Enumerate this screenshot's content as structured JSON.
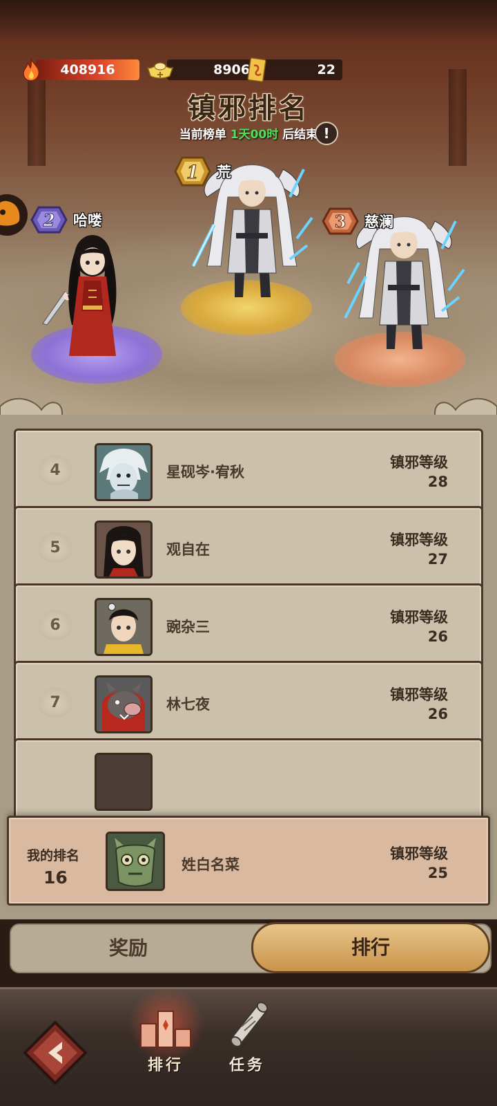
{
  "currency": {
    "flame": "408916",
    "gold": "8906",
    "ticket": "22"
  },
  "header": {
    "title": "镇邪排名",
    "timer_prefix": "当前榜单",
    "timer_value": "1天00时",
    "timer_suffix": "后结束",
    "info_symbol": "!"
  },
  "podium": [
    {
      "rank": "1",
      "name": "荒"
    },
    {
      "rank": "2",
      "name": "哈喽"
    },
    {
      "rank": "3",
      "name": "慈澜"
    }
  ],
  "ranking": {
    "level_label": "镇邪等级",
    "rows": [
      {
        "rank": "4",
        "name": "星砚岑·宥秋",
        "level": "28"
      },
      {
        "rank": "5",
        "name": "观自在",
        "level": "27"
      },
      {
        "rank": "6",
        "name": "豌杂三",
        "level": "26"
      },
      {
        "rank": "7",
        "name": "林七夜",
        "level": "26"
      }
    ]
  },
  "my_rank": {
    "label": "我的排名",
    "rank": "16",
    "name": "姓白名菜",
    "level_label": "镇邪等级",
    "level": "25"
  },
  "tabs": {
    "reward": "奖励",
    "rank": "排行"
  },
  "nav": {
    "rank": "排行",
    "task": "任务"
  }
}
